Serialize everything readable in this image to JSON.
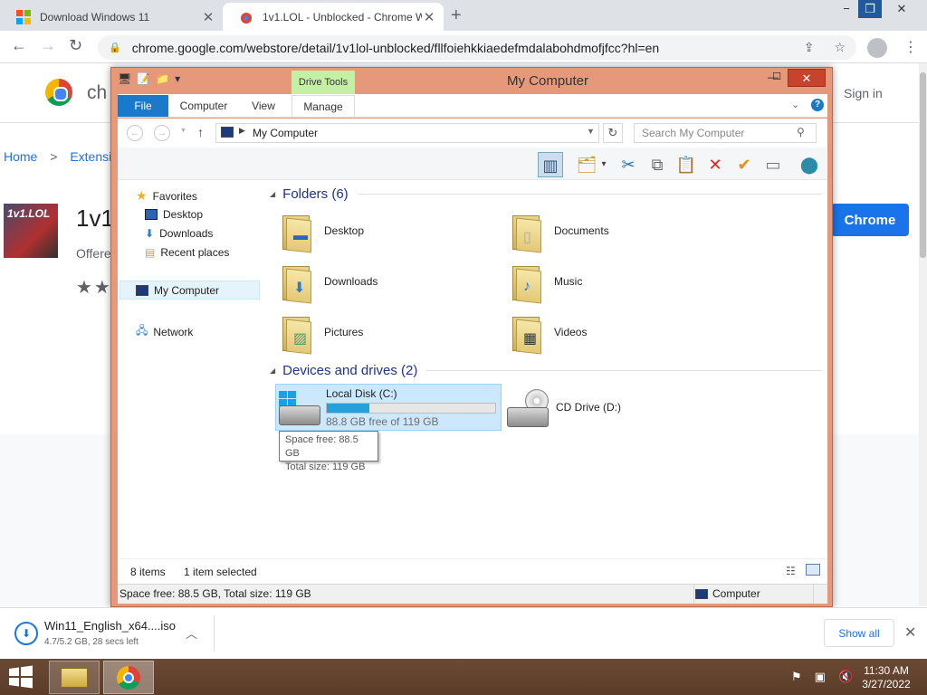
{
  "browser": {
    "tabs": [
      {
        "title": "Download Windows 11",
        "icon": "windows-logo-icon"
      },
      {
        "title": "1v1.LOL - Unblocked - Chrome W",
        "icon": "chrome-webstore-icon"
      }
    ],
    "new_tab": "+",
    "window_controls": [
      "−",
      "❐",
      "✕"
    ],
    "url": "chrome.google.com/webstore/detail/1v1lol-unblocked/fllfoiehkkiaedefmdalabohdmofjfcc?hl=en"
  },
  "webpage": {
    "brand": "ch",
    "sign_in": "Sign in",
    "breadcrumb_home": "Home",
    "breadcrumb_sep": ">",
    "breadcrumb_ext": "Extensi",
    "ext_icon_text": "1v1.LOL",
    "ext_title": "1v1.",
    "offered": "Offere",
    "stars": "★★",
    "add_button": "Chrome"
  },
  "explorer": {
    "title": "My Computer",
    "context_tab": "Drive Tools",
    "ribbon_tabs": [
      "File",
      "Computer",
      "View",
      "Manage"
    ],
    "address": "My Computer",
    "search_placeholder": "Search My Computer",
    "nav": {
      "favorites": "Favorites",
      "desktop": "Desktop",
      "downloads": "Downloads",
      "recent": "Recent places",
      "my_computer": "My Computer",
      "network": "Network"
    },
    "folders_header": "Folders (6)",
    "folders": [
      "Desktop",
      "Documents",
      "Downloads",
      "Music",
      "Pictures",
      "Videos"
    ],
    "devices_header": "Devices and drives (2)",
    "drive_c": {
      "name": "Local Disk (C:)",
      "free": "88.8 GB free of 119 GB",
      "used_fraction": 0.25
    },
    "drive_d": {
      "name": "CD Drive (D:)"
    },
    "tooltip": {
      "line1": "Space free: 88.5 GB",
      "line2": "Total size: 119 GB"
    },
    "status_items": "8 items",
    "status_selected": "1 item selected",
    "status_space": "Space free: 88.5 GB, Total size: 119 GB",
    "status_location": "Computer"
  },
  "download": {
    "filename": "Win11_English_x64....iso",
    "status": "4.7/5.2 GB, 28 secs left",
    "show_all": "Show all"
  },
  "taskbar": {
    "time": "11:30 AM",
    "date": "3/27/2022"
  },
  "colors": {
    "window_frame": "#e6987a",
    "file_tab": "#1979ca",
    "drive_tools": "#c6efa6",
    "chrome_blue": "#1a73e8",
    "taskbar": "#5a3c29"
  }
}
